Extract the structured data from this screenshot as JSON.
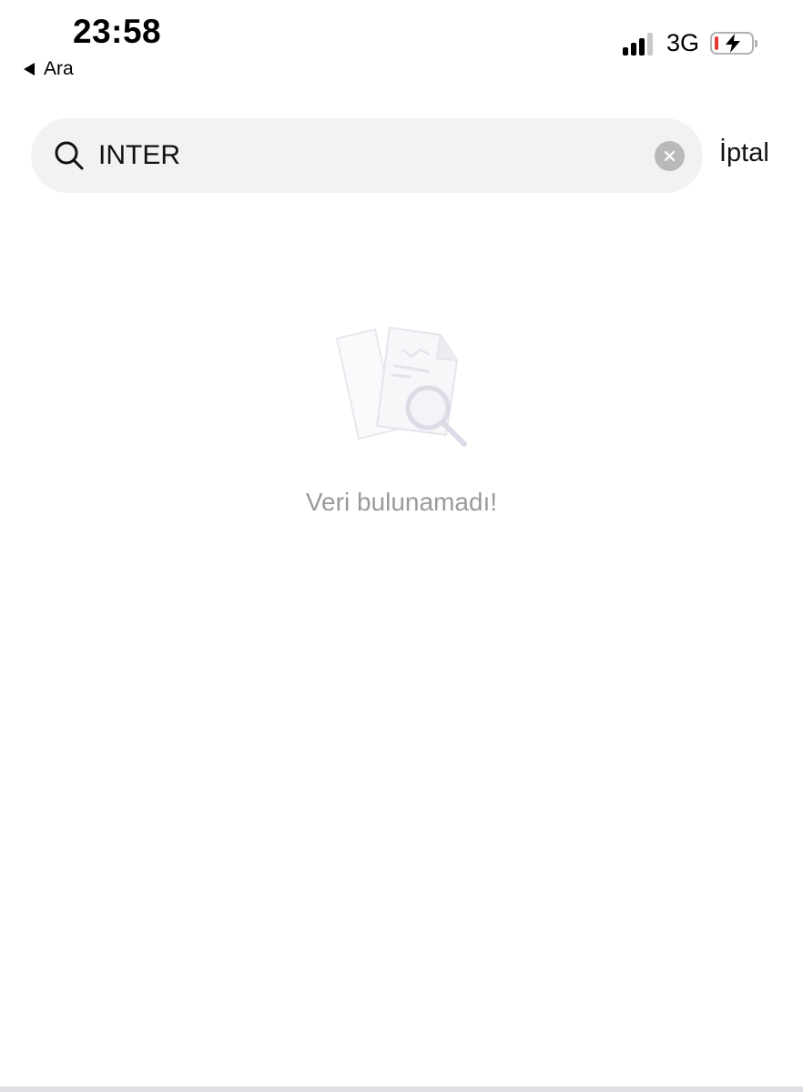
{
  "status_bar": {
    "time": "23:58",
    "back_app_label": "Ara",
    "network": "3G"
  },
  "search": {
    "value": "INTER",
    "cancel_label": "İptal"
  },
  "empty_state": {
    "message": "Veri bulunamadı!"
  },
  "icons": {
    "search": "search-icon",
    "clear": "clear-icon",
    "back": "back-triangle-icon",
    "empty": "document-search-icon"
  },
  "colors": {
    "background": "#ffffff",
    "search_background": "#f2f2f2",
    "muted_text": "#9a9a9a",
    "battery_low": "#e53935"
  }
}
